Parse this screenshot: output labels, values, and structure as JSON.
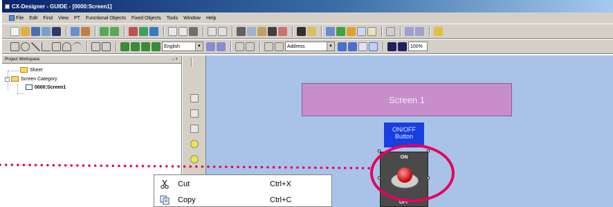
{
  "window": {
    "title": "CX-Designer - GUIDE - [0000:Screen1]"
  },
  "menu": [
    "File",
    "Edit",
    "Find",
    "View",
    "PT",
    "Functional Objects",
    "Fixed Objects",
    "Tools",
    "Window",
    "Help"
  ],
  "toolbar2": {
    "language": "English",
    "address": "Address",
    "zoom": "100%"
  },
  "workspace": {
    "title": "Project Workspace",
    "pin": "– ×",
    "tree": {
      "sheet": "Sheet",
      "category": "Screen Category",
      "screen": "0000:Screen1"
    }
  },
  "canvas": {
    "screen_title": "Screen 1",
    "onoff_label": "ON/OFF\nButton",
    "switch_on": "ON",
    "switch_off": "OFF"
  },
  "context_menu": {
    "items": [
      {
        "label": "Cut",
        "shortcut": "Ctrl+X",
        "icon": "scissors-icon"
      },
      {
        "label": "Copy",
        "shortcut": "Ctrl+C",
        "icon": "copy-icon"
      }
    ]
  },
  "colors": {
    "highlight": "#e6005c",
    "canvas": "#a9c3e8",
    "screen_title": "#c78ecb",
    "button_label": "#1a3ee0"
  }
}
